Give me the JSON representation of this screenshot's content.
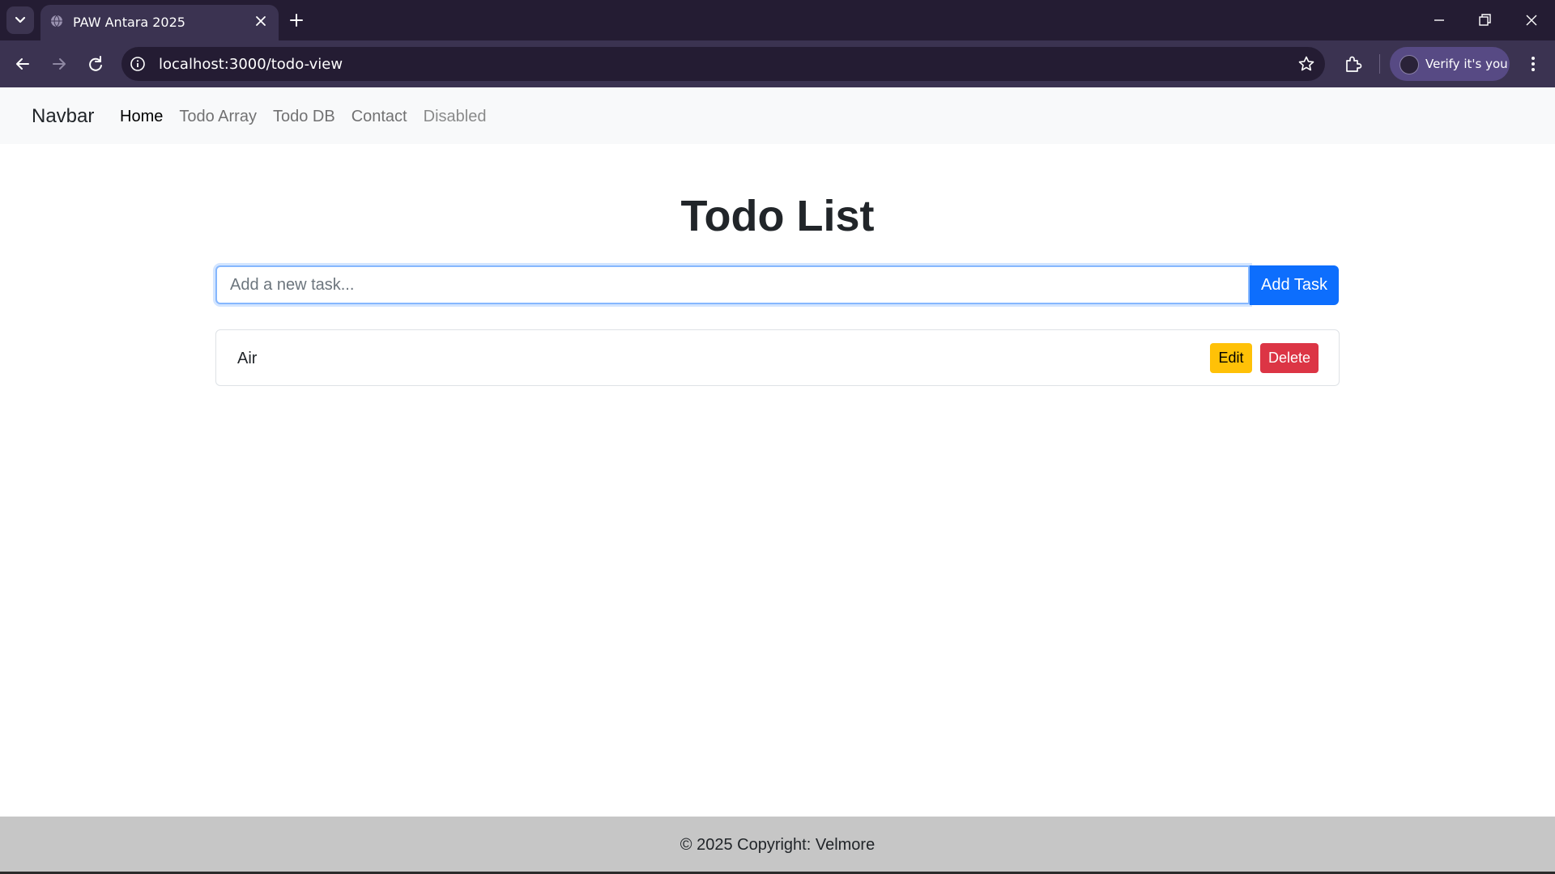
{
  "browser": {
    "tab_title": "PAW Antara 2025",
    "url": "localhost:3000/todo-view",
    "profile_label": "Verify it's you"
  },
  "navbar": {
    "brand": "Navbar",
    "links": [
      {
        "label": "Home",
        "state": "active"
      },
      {
        "label": "Todo Array",
        "state": "normal"
      },
      {
        "label": "Todo DB",
        "state": "normal"
      },
      {
        "label": "Contact",
        "state": "normal"
      },
      {
        "label": "Disabled",
        "state": "disabled"
      }
    ]
  },
  "main": {
    "title": "Todo List",
    "input": {
      "placeholder": "Add a new task...",
      "value": ""
    },
    "add_button": "Add Task",
    "tasks": [
      {
        "text": "Air",
        "edit_label": "Edit",
        "delete_label": "Delete"
      }
    ]
  },
  "footer": {
    "text": "© 2025 Copyright: Velmore"
  },
  "colors": {
    "primary": "#0d6efd",
    "warning": "#ffc107",
    "danger": "#dc3545",
    "browser_frame": "#241c33",
    "browser_toolbar": "#3b3351",
    "footer_bg": "#c6c6c6"
  }
}
